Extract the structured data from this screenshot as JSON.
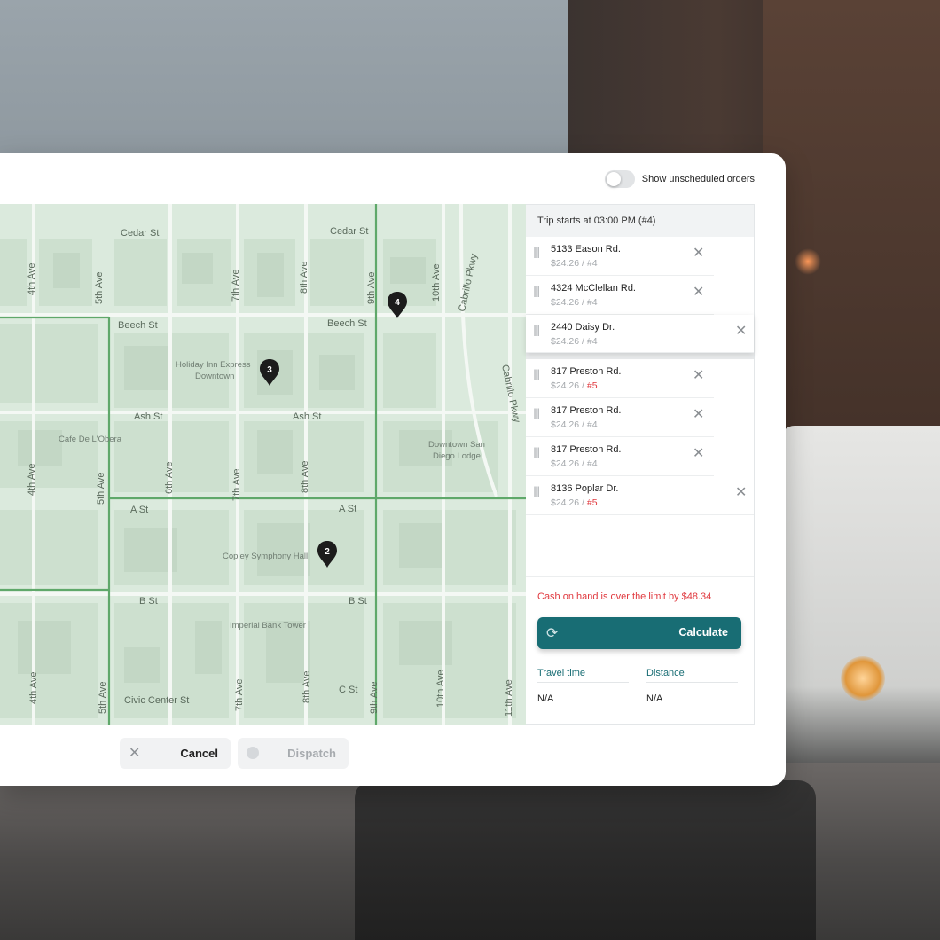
{
  "toggle": {
    "label": "Show unscheduled orders",
    "on": false
  },
  "trip": {
    "header": "Trip starts at 03:00 PM (#4)",
    "stops_group1": [
      {
        "address": "5133 Eason Rd.",
        "price": "$24.26 /",
        "order": "#4",
        "order_red": false
      },
      {
        "address": "4324 McClellan Rd.",
        "price": "$24.26 /",
        "order": "#4",
        "order_red": false
      },
      {
        "address": "2440 Daisy Dr.",
        "price": "$24.26 /",
        "order": "#4",
        "order_red": false
      }
    ],
    "stops_group2": [
      {
        "address": "817 Preston Rd.",
        "price": "$24.26 /",
        "order": "#5",
        "order_red": true
      },
      {
        "address": "817 Preston Rd.",
        "price": "$24.26 /",
        "order": "#4",
        "order_red": false
      },
      {
        "address": "817 Preston Rd.",
        "price": "$24.26 /",
        "order": "#4",
        "order_red": false
      },
      {
        "address": "8136 Poplar Dr.",
        "price": "$24.26 /",
        "order": "#5",
        "order_red": true
      }
    ],
    "warning": "Cash on hand is over the limit by $48.34",
    "calculate_label": "Calculate",
    "travel_time": {
      "label": "Travel time",
      "value": "N/A"
    },
    "distance": {
      "label": "Distance",
      "value": "N/A"
    }
  },
  "footer": {
    "cancel_label": "Cancel",
    "dispatch_label": "Dispatch"
  },
  "map": {
    "streets": {
      "cedar_1": "Cedar St",
      "cedar_2": "Cedar St",
      "beech_1": "Beech St",
      "beech_2": "Beech St",
      "ash_1": "Ash St",
      "ash_2": "Ash St",
      "a_1": "A St",
      "a_2": "A St",
      "b_1": "B St",
      "b_2": "B St",
      "c_1": "C St",
      "civic": "Civic Center St",
      "ave4_1": "4th Ave",
      "ave4_2": "4th Ave",
      "ave4_3": "4th Ave",
      "ave5_1": "5th Ave",
      "ave5_2": "5th Ave",
      "ave5_3": "5th Ave",
      "ave6": "6th Ave",
      "ave7_1": "7th Ave",
      "ave7_2": "7th Ave",
      "ave7_3": "7th Ave",
      "ave8_1": "8th Ave",
      "ave8_2": "8th Ave",
      "ave8_3": "8th Ave",
      "ave9_1": "9th Ave",
      "ave9_2": "9th Ave",
      "ave10_1": "10th Ave",
      "ave10_2": "10th Ave",
      "ave11": "11th Ave",
      "cabrillo_1": "Cabrillo Pkwy",
      "cabrillo_2": "Cabrillo Pkwy"
    },
    "pois": {
      "holiday_1": "Holiday Inn Express",
      "holiday_2": "Downtown",
      "cafe": "Cafe De L'Obera",
      "dsd_1": "Downtown San",
      "dsd_2": "Diego Lodge",
      "copley": "Copley Symphony Hall",
      "imperial": "Imperial Bank Tower"
    },
    "pins": [
      "4",
      "3",
      "2"
    ]
  },
  "colors": {
    "accent": "#186d74",
    "warning": "#e0383e",
    "map_bg": "#dbeadd",
    "route": "#5fa86a"
  }
}
